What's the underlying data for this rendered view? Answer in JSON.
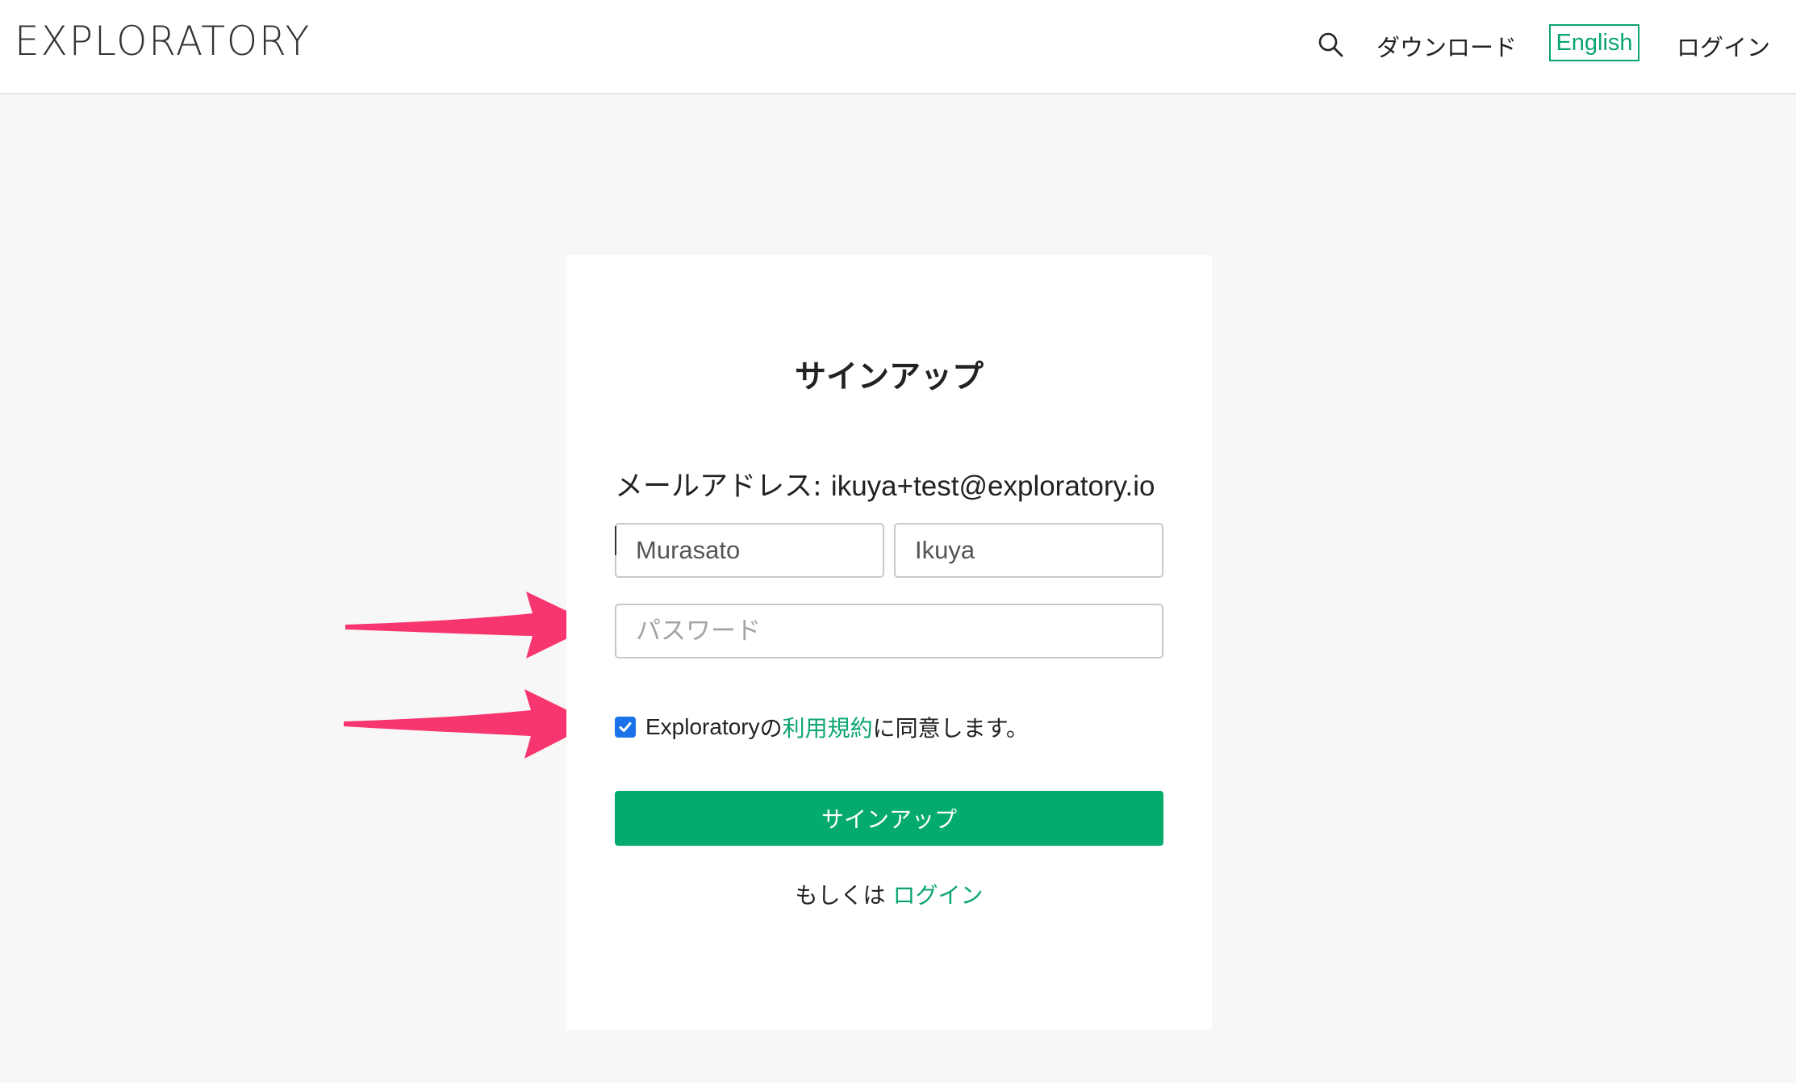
{
  "header": {
    "logo_text": "EXPLORATORY",
    "search_icon": "search-icon",
    "download_label": "ダウンロード",
    "language_label": "English",
    "login_label": "ログイン"
  },
  "signup": {
    "title": "サインアップ",
    "email_label": "メールアドレス: ",
    "email_value": "ikuya+test@exploratory.io",
    "last_name_value": "Murasato",
    "first_name_value": "Ikuya",
    "password_placeholder": "パスワード",
    "terms": {
      "checked": true,
      "prefix_brand": "Exploratory",
      "prefix_particle": "の",
      "link_text": "利用規約",
      "suffix": "に同意します。"
    },
    "submit_label": "サインアップ",
    "or_text": "もしくは ",
    "login_link": "ログイン"
  },
  "colors": {
    "accent_green": "#05aa6d",
    "link_green": "#0aa56e",
    "annotation_arrow": "#f7366f",
    "checkbox_blue": "#1a73e8"
  },
  "annotations": {
    "arrow_icon": "annotation-arrow-icon"
  }
}
